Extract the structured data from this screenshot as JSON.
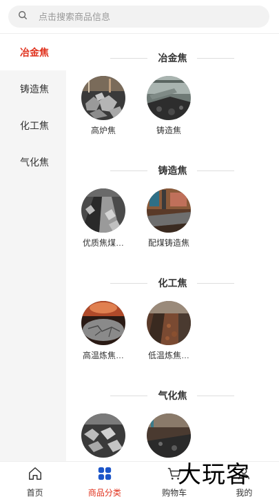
{
  "search": {
    "placeholder": "点击搜索商品信息"
  },
  "sidebar": {
    "items": [
      {
        "label": "冶金焦",
        "active": true
      },
      {
        "label": "铸造焦",
        "active": false
      },
      {
        "label": "化工焦",
        "active": false
      },
      {
        "label": "气化焦",
        "active": false
      }
    ]
  },
  "sections": [
    {
      "title": "冶金焦",
      "products": [
        {
          "name": "高炉焦"
        },
        {
          "name": "铸造焦"
        }
      ]
    },
    {
      "title": "铸造焦",
      "products": [
        {
          "name": "优质焦煤…"
        },
        {
          "name": "配煤铸造焦"
        }
      ]
    },
    {
      "title": "化工焦",
      "products": [
        {
          "name": "高温炼焦…"
        },
        {
          "name": "低温炼焦…"
        }
      ]
    },
    {
      "title": "气化焦",
      "products": [
        {
          "name": ""
        },
        {
          "name": ""
        }
      ]
    }
  ],
  "tabbar": {
    "tabs": [
      {
        "label": "首页",
        "icon": "home-icon"
      },
      {
        "label": "商品分类",
        "icon": "category-grid-icon",
        "active": true
      },
      {
        "label": "购物车",
        "icon": "cart-icon"
      },
      {
        "label": "我的",
        "icon": "user-icon"
      }
    ]
  },
  "watermark": "大玩客",
  "colors": {
    "accent": "#e0311d",
    "category_icon": "#1d56c9",
    "sidebar_bg": "#f5f5f5",
    "search_bg": "#f2f2f2"
  }
}
